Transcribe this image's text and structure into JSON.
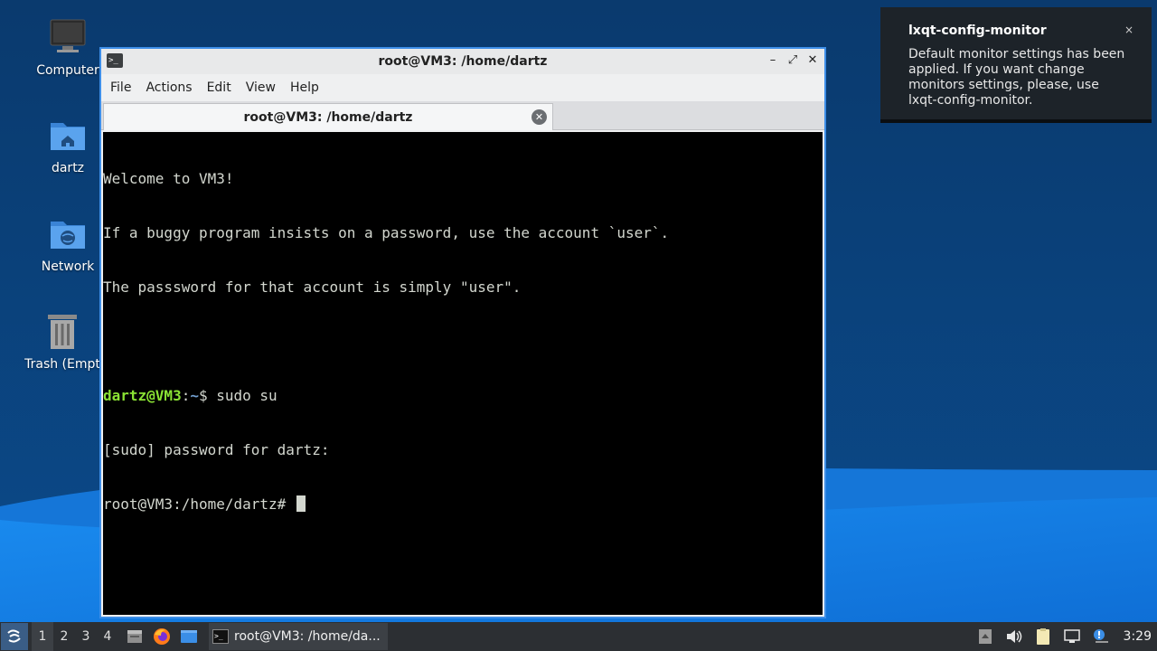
{
  "desktop": {
    "icons": [
      {
        "label": "Computer",
        "icon": "computer-icon"
      },
      {
        "label": "dartz",
        "icon": "home-folder-icon"
      },
      {
        "label": "Network",
        "icon": "network-folder-icon"
      },
      {
        "label": "Trash (Empt",
        "icon": "trash-icon"
      }
    ]
  },
  "window": {
    "title": "root@VM3: /home/dartz",
    "controls": {
      "minimize": "–",
      "maximize": "⤢",
      "close": "✕"
    },
    "menu": [
      "File",
      "Actions",
      "Edit",
      "View",
      "Help"
    ],
    "tab": {
      "label": "root@VM3: /home/dartz",
      "close": "✕"
    }
  },
  "terminal": {
    "lines": [
      "Welcome to VM3!",
      "If a buggy program insists on a password, use the account `user`.",
      "The passsword for that account is simply \"user\".",
      ""
    ],
    "prompt": {
      "user_host": "dartz@VM3",
      "sep": ":",
      "path": "~",
      "symbol": "$ ",
      "command": "sudo su"
    },
    "sudo_line": "[sudo] password for dartz:",
    "root_prompt": "root@VM3:/home/dartz# "
  },
  "notification": {
    "title": "lxqt-config-monitor",
    "body": "Default monitor settings has been applied. If you want change monitors settings, please, use lxqt-config-monitor.",
    "close": "×"
  },
  "taskbar": {
    "desktops": [
      "1",
      "2",
      "3",
      "4"
    ],
    "active_desktop": "1",
    "task_label": "root@VM3: /home/da...",
    "clock": "3:29"
  },
  "colors": {
    "accent": "#3d8ee8",
    "terminal_bg": "#000000",
    "prompt_user": "#8ae234",
    "prompt_path": "#729fcf"
  }
}
